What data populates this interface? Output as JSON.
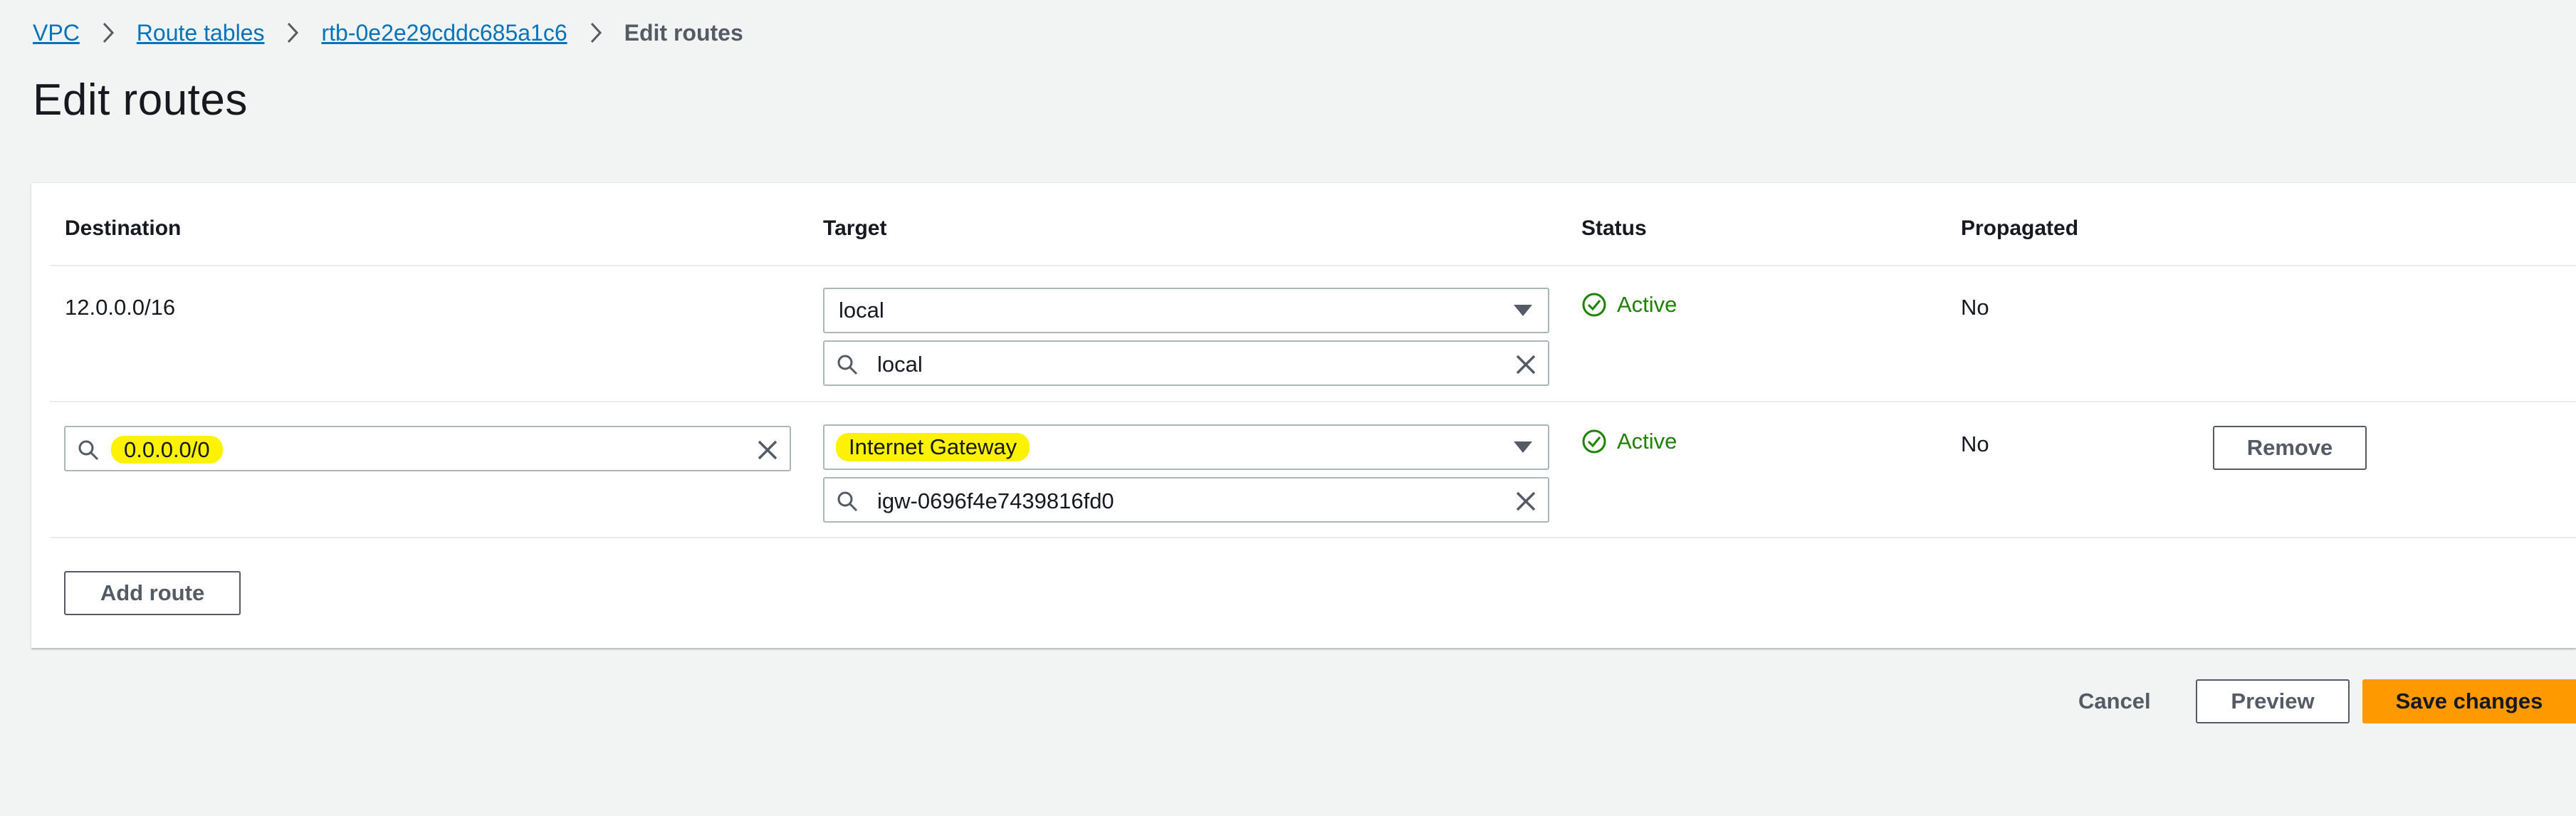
{
  "breadcrumb": {
    "vpc": "VPC",
    "route_tables": "Route tables",
    "route_table_id": "rtb-0e2e29cddc685a1c6",
    "current": "Edit routes"
  },
  "page_title": "Edit routes",
  "table": {
    "columns": [
      "Destination",
      "Target",
      "Status",
      "Propagated"
    ],
    "rows": [
      {
        "destination": "12.0.0.0/16",
        "target_type": "local",
        "target_search": "local",
        "status": "Active",
        "propagated": "No"
      },
      {
        "destination": "0.0.0.0/0",
        "target_type": "Internet Gateway",
        "target_search": "igw-0696f4e7439816fd0",
        "status": "Active",
        "propagated": "No",
        "remove_label": "Remove"
      }
    ]
  },
  "add_route_label": "Add route",
  "footer": {
    "cancel": "Cancel",
    "preview": "Preview",
    "save": "Save changes"
  },
  "colors": {
    "link": "#0073bb",
    "status_active": "#1d8102",
    "primary": "#ff9900",
    "highlight": "#fff200"
  }
}
